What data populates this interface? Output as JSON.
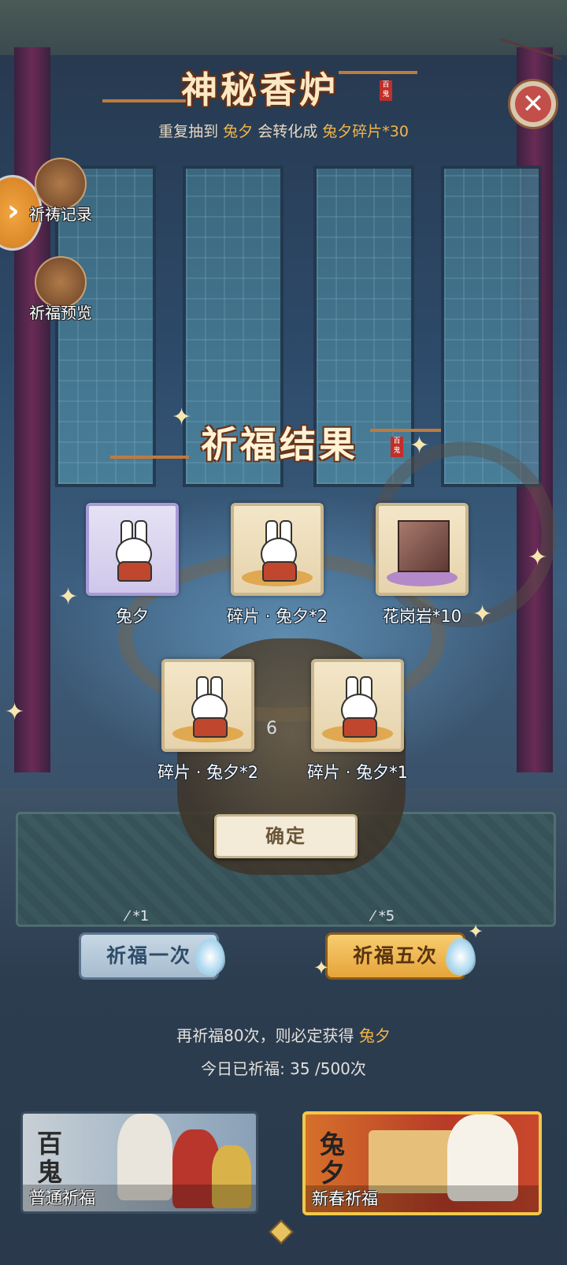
{
  "header": {
    "title": "神秘香炉",
    "seal_text": "百鬼",
    "hint_prefix": "重复抽到",
    "hint_char": "兔夕",
    "hint_middle": "会转化成",
    "hint_reward": "兔夕碎片*30"
  },
  "side": {
    "record_label": "祈祷记录",
    "preview_label": "祈福预览"
  },
  "result": {
    "title": "祈福结果",
    "seal_text": "百鬼",
    "items": [
      {
        "label": "兔夕",
        "icon": "bunny-character-icon"
      },
      {
        "label": "碎片 · 兔夕*2",
        "icon": "bunny-fragment-icon"
      },
      {
        "label": "花岗岩*10",
        "icon": "granite-icon"
      },
      {
        "label": "碎片 · 兔夕*2",
        "icon": "bunny-fragment-icon"
      },
      {
        "label": "碎片 · 兔夕*1",
        "icon": "bunny-fragment-icon"
      }
    ],
    "center_number": "6",
    "confirm_label": "确定"
  },
  "pray": {
    "once_cost": "*1",
    "once_label": "祈福一次",
    "five_cost": "*5",
    "five_label": "祈福五次"
  },
  "info": {
    "guarantee_prefix": "再祈福80次，则必定获得",
    "guarantee_char": "兔夕",
    "today_text": "今日已祈福: 35 /500次"
  },
  "pools": {
    "normal_big": "百鬼",
    "normal_name": "普通祈福",
    "spring_big": "兔夕",
    "spring_name": "新春祈福"
  },
  "colors": {
    "highlight": "#f3b64a",
    "title_text": "#fbe8c4",
    "close_red": "#c24f4a"
  }
}
